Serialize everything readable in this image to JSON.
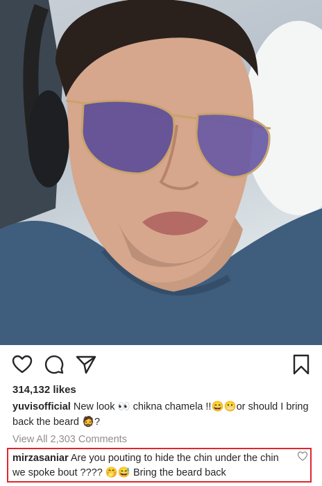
{
  "post": {
    "likes": "314,132 likes",
    "caption": {
      "username": "yuvisofficial",
      "text_1": "New look ",
      "emoji_eyes": "👀",
      "text_2": " chikna chamela !!",
      "emoji_grin": "😄",
      "emoji_grimace": "😬",
      "text_3": "or should I bring back the beard ",
      "emoji_beard": "🧔",
      "text_4": "?"
    },
    "view_all_comments": "View All 2,303 Comments",
    "highlighted_comment": {
      "username": "mirzasaniar",
      "text_1": "Are you pouting to hide the chin under the chin we spoke bout ???? ",
      "emoji_1": "🤭",
      "emoji_2": "😅",
      "text_2": " Bring the beard back"
    }
  },
  "icons": {
    "like": "heart-icon",
    "comment": "comment-bubble-icon",
    "share": "paper-plane-icon",
    "save": "bookmark-icon",
    "comment_like": "small-heart-icon"
  },
  "colors": {
    "highlight_border": "#e0262d",
    "secondary_text": "#8e8e8e",
    "primary_text": "#262626"
  }
}
